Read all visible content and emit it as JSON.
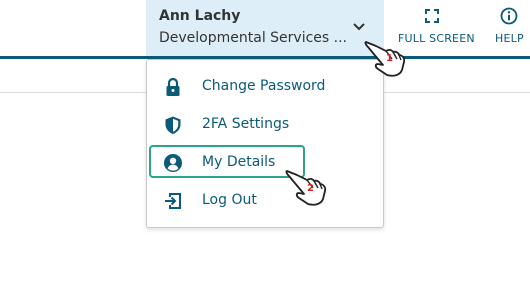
{
  "header": {
    "user_name": "Ann Lachy",
    "user_org": "Developmental Services ...",
    "fullscreen_label": "FULL SCREEN",
    "help_label": "HELP"
  },
  "menu": {
    "items": [
      {
        "label": "Change Password",
        "icon": "lock-icon"
      },
      {
        "label": "2FA Settings",
        "icon": "shield-icon"
      },
      {
        "label": "My Details",
        "icon": "user-circle-icon"
      },
      {
        "label": "Log Out",
        "icon": "logout-icon"
      }
    ]
  },
  "annotations": {
    "step1": "1",
    "step2": "2"
  },
  "colors": {
    "accent": "#0b5a79",
    "user_box_bg": "#deeef8",
    "highlight": "#2aa58a",
    "step_number": "#d41f1f"
  }
}
